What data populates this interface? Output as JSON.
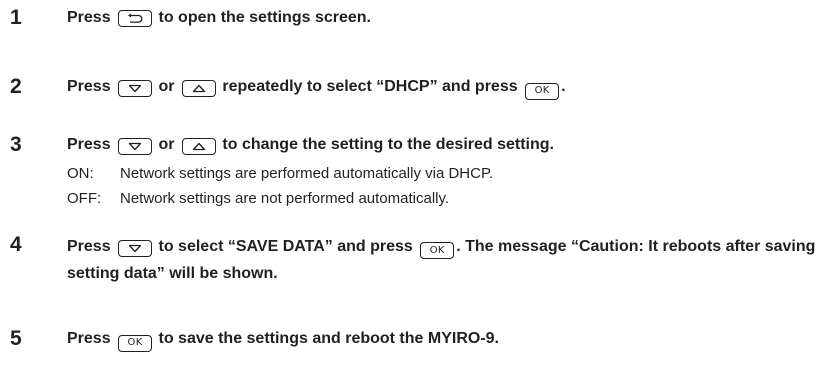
{
  "steps": [
    {
      "number": "1",
      "parts": [
        "Press",
        "to open the settings screen."
      ]
    },
    {
      "number": "2",
      "parts": [
        "Press",
        "or",
        "repeatedly to select “DHCP” and press",
        "."
      ]
    },
    {
      "number": "3",
      "parts": [
        "Press",
        "or",
        "to change the setting to the desired setting."
      ],
      "options": [
        {
          "term": "ON:",
          "desc": "Network settings are performed automatically via DHCP."
        },
        {
          "term": "OFF:",
          "desc": "Network settings are not performed automatically."
        }
      ]
    },
    {
      "number": "4",
      "parts": [
        "Press",
        "to select “SAVE DATA” and press",
        ". The message “Caution: It reboots after saving setting data” will be shown."
      ]
    },
    {
      "number": "5",
      "parts": [
        "Press",
        "to save the settings and reboot the MYIRO-9."
      ]
    }
  ],
  "keys": {
    "back_icon": "return-arrow-icon",
    "down_icon": "down-triangle-icon",
    "up_icon": "up-triangle-icon",
    "ok_label": "OK"
  }
}
